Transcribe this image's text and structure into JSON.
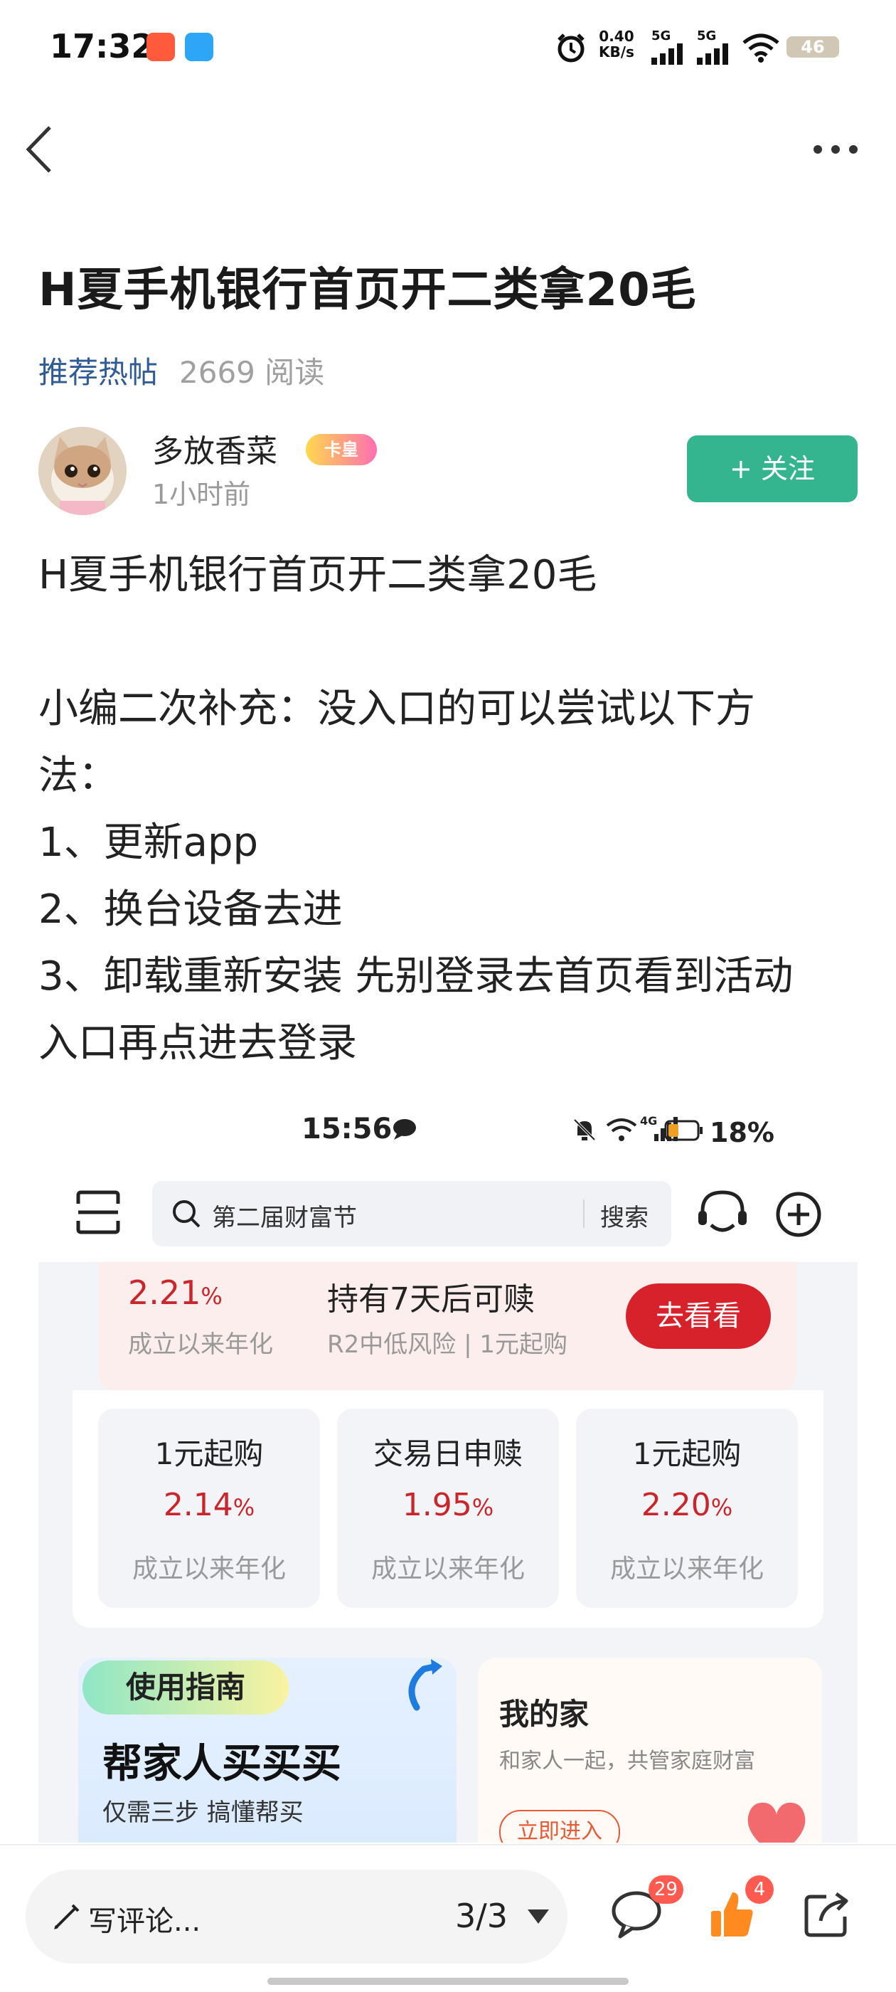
{
  "status_bar": {
    "time": "17:32",
    "net_speed_value": "0.40",
    "net_speed_unit": "KB/s",
    "signal_1": "5G",
    "signal_2": "5G",
    "battery": "46"
  },
  "article": {
    "title": "H夏手机银行首页开二类拿20毛",
    "tag": "推荐热帖",
    "reads": "2669 阅读"
  },
  "author": {
    "name": "多放香菜",
    "badge": "卡皇",
    "time": "1小时前",
    "follow_label": "+ 关注"
  },
  "body": {
    "lines": [
      "H夏手机银行首页开二类拿20毛",
      "",
      "小编二次补充：没入口的可以尝试以下方",
      "法：",
      "1、更新app",
      "2、换台设备去进",
      "3、卸载重新安装 先别登录去首页看到活动",
      "入口再点进去登录"
    ]
  },
  "embedded_screenshot": {
    "status_time": "15:56",
    "status_network": "4G",
    "battery": "18%",
    "search_placeholder": "第二届财富节",
    "search_button": "搜索",
    "promo": {
      "rate": "2.21",
      "rate_unit": "%",
      "rate_label": "成立以来年化",
      "title": "持有7天后可赎",
      "subtitle": "R2中低风险 | 1元起购",
      "button": "去看看"
    },
    "products": [
      {
        "title": "1元起购",
        "rate": "2.14",
        "unit": "%",
        "label": "成立以来年化"
      },
      {
        "title": "交易日申赎",
        "rate": "1.95",
        "unit": "%",
        "label": "成立以来年化"
      },
      {
        "title": "1元起购",
        "rate": "2.20",
        "unit": "%",
        "label": "成立以来年化"
      }
    ],
    "guide": {
      "tag": "使用指南",
      "title": "帮家人买买买",
      "subtitle": "仅需三步 搞懂帮买"
    },
    "home": {
      "title": "我的家",
      "subtitle": "和家人一起，共管家庭财富",
      "button": "立即进入"
    }
  },
  "bottom_bar": {
    "comment_placeholder": "写评论...",
    "page_indicator": "3/3",
    "comments_count": "29",
    "likes_count": "4"
  },
  "colors": {
    "follow_button": "#35b58f",
    "tag_blue": "#2f5b97",
    "rate_red": "#c9252a",
    "badge_red": "#ff5a50"
  }
}
